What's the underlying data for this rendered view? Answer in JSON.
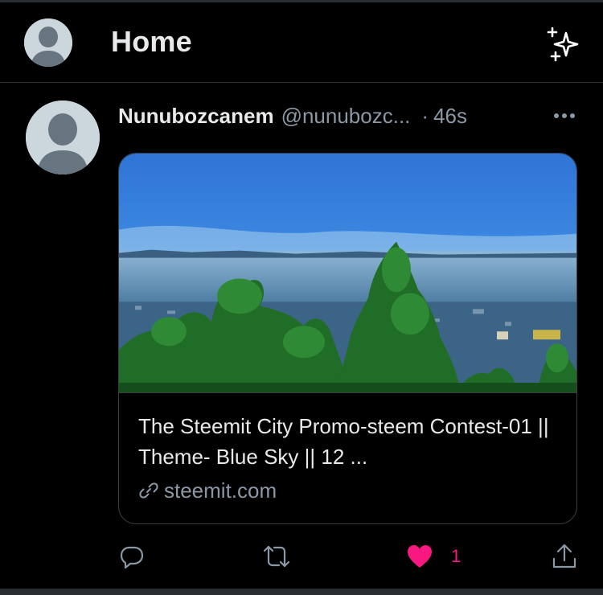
{
  "header": {
    "title": "Home",
    "avatar_icon": "default-avatar-icon",
    "sparkle_icon": "sparkle-icon"
  },
  "tweet": {
    "display_name": "Nunubozcanem",
    "handle": "@nunubozc...",
    "separator": "·",
    "time": "46s",
    "more_icon": "more-dots-icon",
    "card": {
      "title": "The Steemit City Promo-steem Contest-01 || Theme- Blue Sky || 12 ...",
      "source": "steemit.com",
      "link_icon": "link-icon"
    },
    "actions": {
      "reply_icon": "reply-icon",
      "retweet_icon": "retweet-icon",
      "like_icon": "heart-icon",
      "like_count": "1",
      "share_icon": "share-icon"
    }
  },
  "colors": {
    "background": "#000000",
    "text": "#e7e9ea",
    "muted": "#8b98a5",
    "like": "#f91880",
    "border": "#2f3336"
  }
}
